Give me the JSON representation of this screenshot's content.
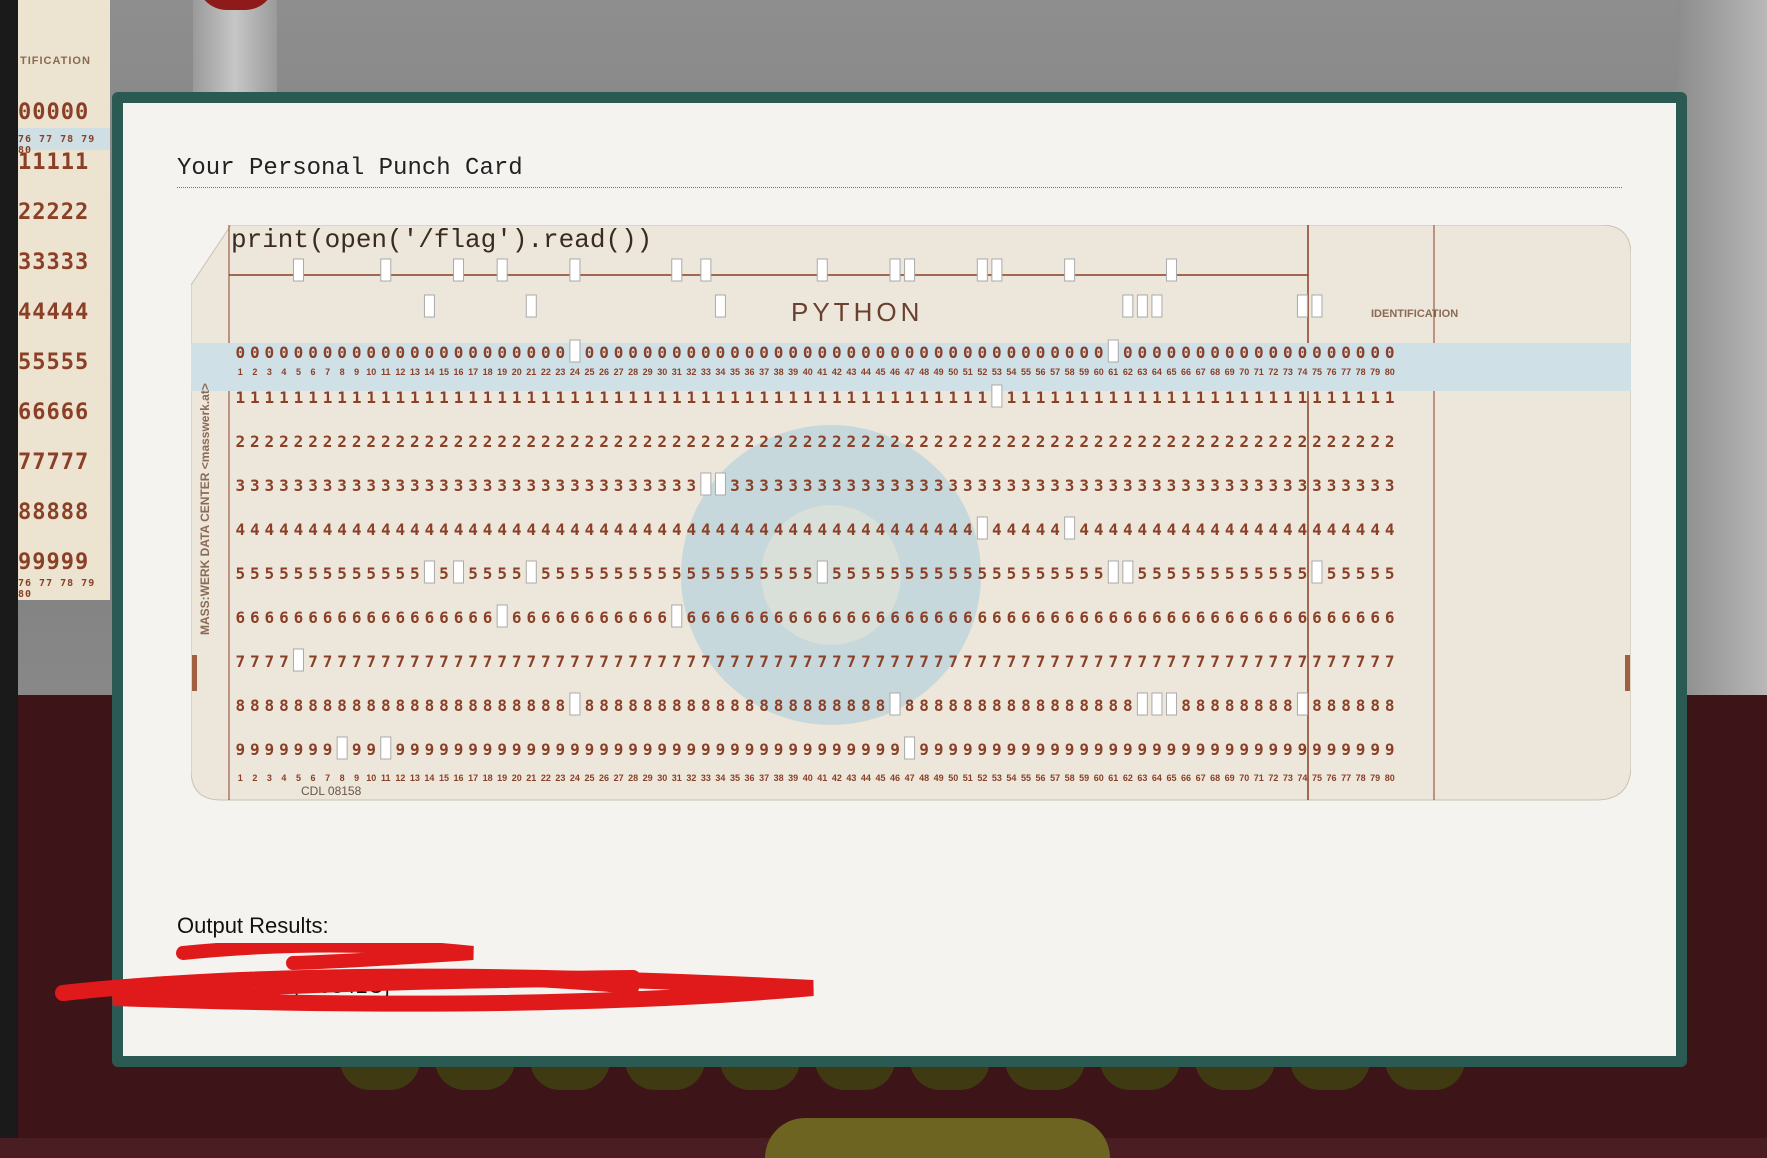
{
  "background": {
    "mini_card_label": "TIFICATION",
    "mini_card_rows": [
      "00000",
      "11111",
      "22222",
      "33333",
      "44444",
      "55555",
      "66666",
      "77777",
      "88888",
      "99999"
    ],
    "mini_card_cols": "76 77 78 79 80"
  },
  "modal": {
    "title": "Your Personal Punch Card",
    "output_label": "Output Results:",
    "output_value": "{...0841C}"
  },
  "card": {
    "printed_code": "print(open('/flag').read())",
    "language_label": "PYTHON",
    "identification_label": "IDENTIFICATION",
    "side_label": "MASS:WERK DATA CENTER  <masswerk.at>",
    "form_number": "CDL  08158",
    "columns": 80,
    "colors": {
      "paper": "#ece7da",
      "ink": "#8a3f26",
      "band": "#cfe0e6",
      "hole": "#ffffff",
      "logo": "#b9d3db"
    },
    "punches": [
      {
        "col": 5,
        "rows": [
          "12",
          "7"
        ]
      },
      {
        "col": 8,
        "rows": [
          "9"
        ]
      },
      {
        "col": 11,
        "rows": [
          "12",
          "9"
        ]
      },
      {
        "col": 14,
        "rows": [
          "11",
          "5"
        ]
      },
      {
        "col": 16,
        "rows": [
          "12",
          "5"
        ]
      },
      {
        "col": 19,
        "rows": [
          "12",
          "6"
        ]
      },
      {
        "col": 21,
        "rows": [
          "11",
          "5"
        ]
      },
      {
        "col": 24,
        "rows": [
          "12",
          "0",
          "8"
        ]
      },
      {
        "col": 31,
        "rows": [
          "12",
          "6"
        ]
      },
      {
        "col": 33,
        "rows": [
          "12",
          "3"
        ]
      },
      {
        "col": 34,
        "rows": [
          "11",
          "3"
        ]
      },
      {
        "col": 41,
        "rows": [
          "12",
          "5"
        ]
      },
      {
        "col": 46,
        "rows": [
          "12",
          "8"
        ]
      },
      {
        "col": 47,
        "rows": [
          "12",
          "9"
        ]
      },
      {
        "col": 52,
        "rows": [
          "12",
          "4"
        ]
      },
      {
        "col": 53,
        "rows": [
          "12",
          "1"
        ]
      },
      {
        "col": 58,
        "rows": [
          "12",
          "4"
        ]
      },
      {
        "col": 61,
        "rows": [
          "0",
          "5"
        ]
      },
      {
        "col": 62,
        "rows": [
          "11",
          "5"
        ]
      },
      {
        "col": 63,
        "rows": [
          "11",
          "8"
        ]
      },
      {
        "col": 64,
        "rows": [
          "11",
          "8"
        ]
      },
      {
        "col": 65,
        "rows": [
          "12",
          "8"
        ]
      },
      {
        "col": 74,
        "rows": [
          "11",
          "8"
        ]
      },
      {
        "col": 75,
        "rows": [
          "11",
          "5"
        ]
      }
    ]
  }
}
